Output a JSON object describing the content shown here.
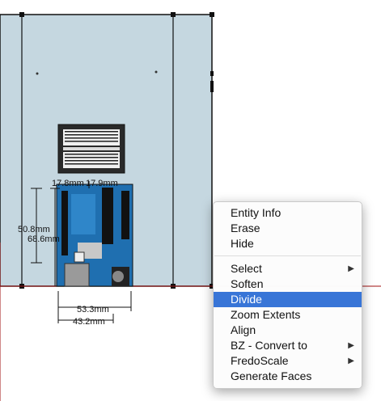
{
  "canvas": {
    "background_color": "#ffffff",
    "model_fill_color": "#c5d7e0",
    "axis_color": "#a01010"
  },
  "dimensions": {
    "top_left": "17.8mm",
    "top_right": "17.9mm",
    "height_inner": "50.8mm",
    "height_outer": "68.6mm",
    "width_inner": "53.3mm",
    "width_outer": "43.2mm"
  },
  "context_menu": {
    "items": [
      {
        "label": "Entity Info",
        "submenu": false,
        "highlighted": false
      },
      {
        "label": "Erase",
        "submenu": false,
        "highlighted": false
      },
      {
        "label": "Hide",
        "submenu": false,
        "highlighted": false
      },
      {
        "label": "Select",
        "submenu": true,
        "highlighted": false
      },
      {
        "label": "Soften",
        "submenu": false,
        "highlighted": false
      },
      {
        "label": "Divide",
        "submenu": false,
        "highlighted": true
      },
      {
        "label": "Zoom Extents",
        "submenu": false,
        "highlighted": false
      },
      {
        "label": "Align",
        "submenu": false,
        "highlighted": false
      },
      {
        "label": "BZ - Convert to",
        "submenu": true,
        "highlighted": false
      },
      {
        "label": "FredoScale",
        "submenu": true,
        "highlighted": false
      },
      {
        "label": "Generate Faces",
        "submenu": false,
        "highlighted": false
      }
    ],
    "submenu_arrow": "▶",
    "highlight_color": "#3875d7"
  }
}
